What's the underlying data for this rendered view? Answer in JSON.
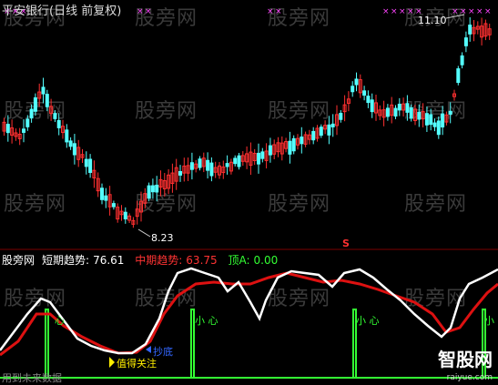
{
  "upper_panel": {
    "title": "平安银行(日线 前复权)",
    "high_label": "11.10",
    "low_label": "8.23",
    "signal_label": "S"
  },
  "lower_panel": {
    "prefix": "股旁网",
    "indicator_name": "短期趋势",
    "short_trend_label": "短期趋势:",
    "short_trend_value": "76.61",
    "mid_trend_label": "中期趋势:",
    "mid_trend_value": "63.75",
    "top_label": "顶A:",
    "top_value": "0.00",
    "annotations": {
      "attention": "值得关注",
      "bottom_copy": "抄底",
      "heart1": "心",
      "heart2": "小 心",
      "heart3": "小 心",
      "heart4": "小"
    },
    "footer_text": "用到未来数据"
  },
  "watermark": "股旁网",
  "brand": {
    "name": "智股网",
    "url": "raiyue.com"
  },
  "colors": {
    "background": "#000000",
    "candle_up": "#ff3030",
    "candle_down": "#54ffff",
    "white_line": "#ffffff",
    "red_line": "#dd1111",
    "green_signal": "#33ff33",
    "magenta_marks": "#ff44ff",
    "title_text": "#dddddd",
    "short_trend_color": "#ffffff",
    "mid_trend_color": "#ff3333",
    "top_a_color": "#33ff33"
  }
}
